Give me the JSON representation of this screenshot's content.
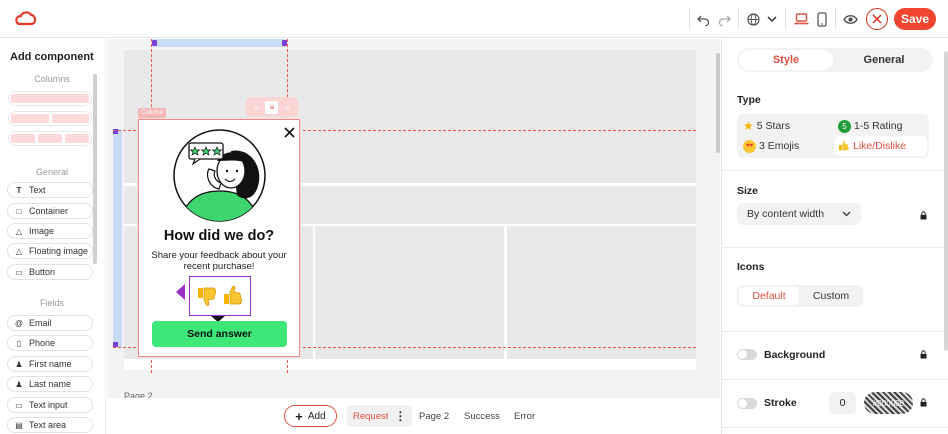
{
  "toolbar": {
    "save_label": "Save",
    "icons": [
      "undo-icon",
      "redo-icon",
      "globe-icon",
      "chevron-down-icon",
      "laptop-icon",
      "mobile-icon",
      "eye-icon",
      "close-icon"
    ]
  },
  "left_panel": {
    "title": "Add component",
    "columns_label": "Columns",
    "general_label": "General",
    "general_items": [
      {
        "label": "Text",
        "icon": "text-icon"
      },
      {
        "label": "Container",
        "icon": "container-icon"
      },
      {
        "label": "Image",
        "icon": "image-icon"
      },
      {
        "label": "Floating image",
        "icon": "floating-image-icon"
      },
      {
        "label": "Button",
        "icon": "button-icon"
      }
    ],
    "fields_label": "Fields",
    "field_items": [
      {
        "label": "Email",
        "icon": "at-icon"
      },
      {
        "label": "Phone",
        "icon": "phone-icon"
      },
      {
        "label": "First name",
        "icon": "person-icon"
      },
      {
        "label": "Last name",
        "icon": "person-icon"
      },
      {
        "label": "Text input",
        "icon": "text-input-icon"
      },
      {
        "label": "Text area",
        "icon": "text-area-icon"
      }
    ]
  },
  "canvas": {
    "page_label": "Page 2",
    "column_badge": "Column",
    "popup": {
      "heading": "How did we do?",
      "subtext": "Share your feedback about your recent purchase!",
      "button_label": "Send answer",
      "rating_icons": [
        "thumbs-down",
        "thumbs-up"
      ]
    }
  },
  "bottom_bar": {
    "add_label": "Add",
    "tabs": [
      "Request",
      "Page 2",
      "Success",
      "Error"
    ],
    "active_tab": "Request"
  },
  "right_panel": {
    "tabs": [
      "Style",
      "General"
    ],
    "active_tab": "Style",
    "type_label": "Type",
    "type_options": [
      {
        "label": "5 Stars",
        "icon": "star-icon"
      },
      {
        "label": "1-5 Rating",
        "icon": "number-badge-icon",
        "badge": "5"
      },
      {
        "label": "3 Emojis",
        "icon": "heart-eyes-emoji-icon"
      },
      {
        "label": "Like/Dislike",
        "icon": "thumbs-up-icon"
      }
    ],
    "selected_type": "Like/Dislike",
    "size_label": "Size",
    "size_value": "By content width",
    "icons_label": "Icons",
    "icons_options": [
      "Default",
      "Custom"
    ],
    "icons_selected": "Default",
    "background_label": "Background",
    "stroke_label": "Stroke",
    "stroke_width": "0",
    "stroke_color": "#000000"
  },
  "colors": {
    "accent": "#f2452f",
    "send_button": "#3ee878",
    "selection_outline": "#9b30c8"
  }
}
